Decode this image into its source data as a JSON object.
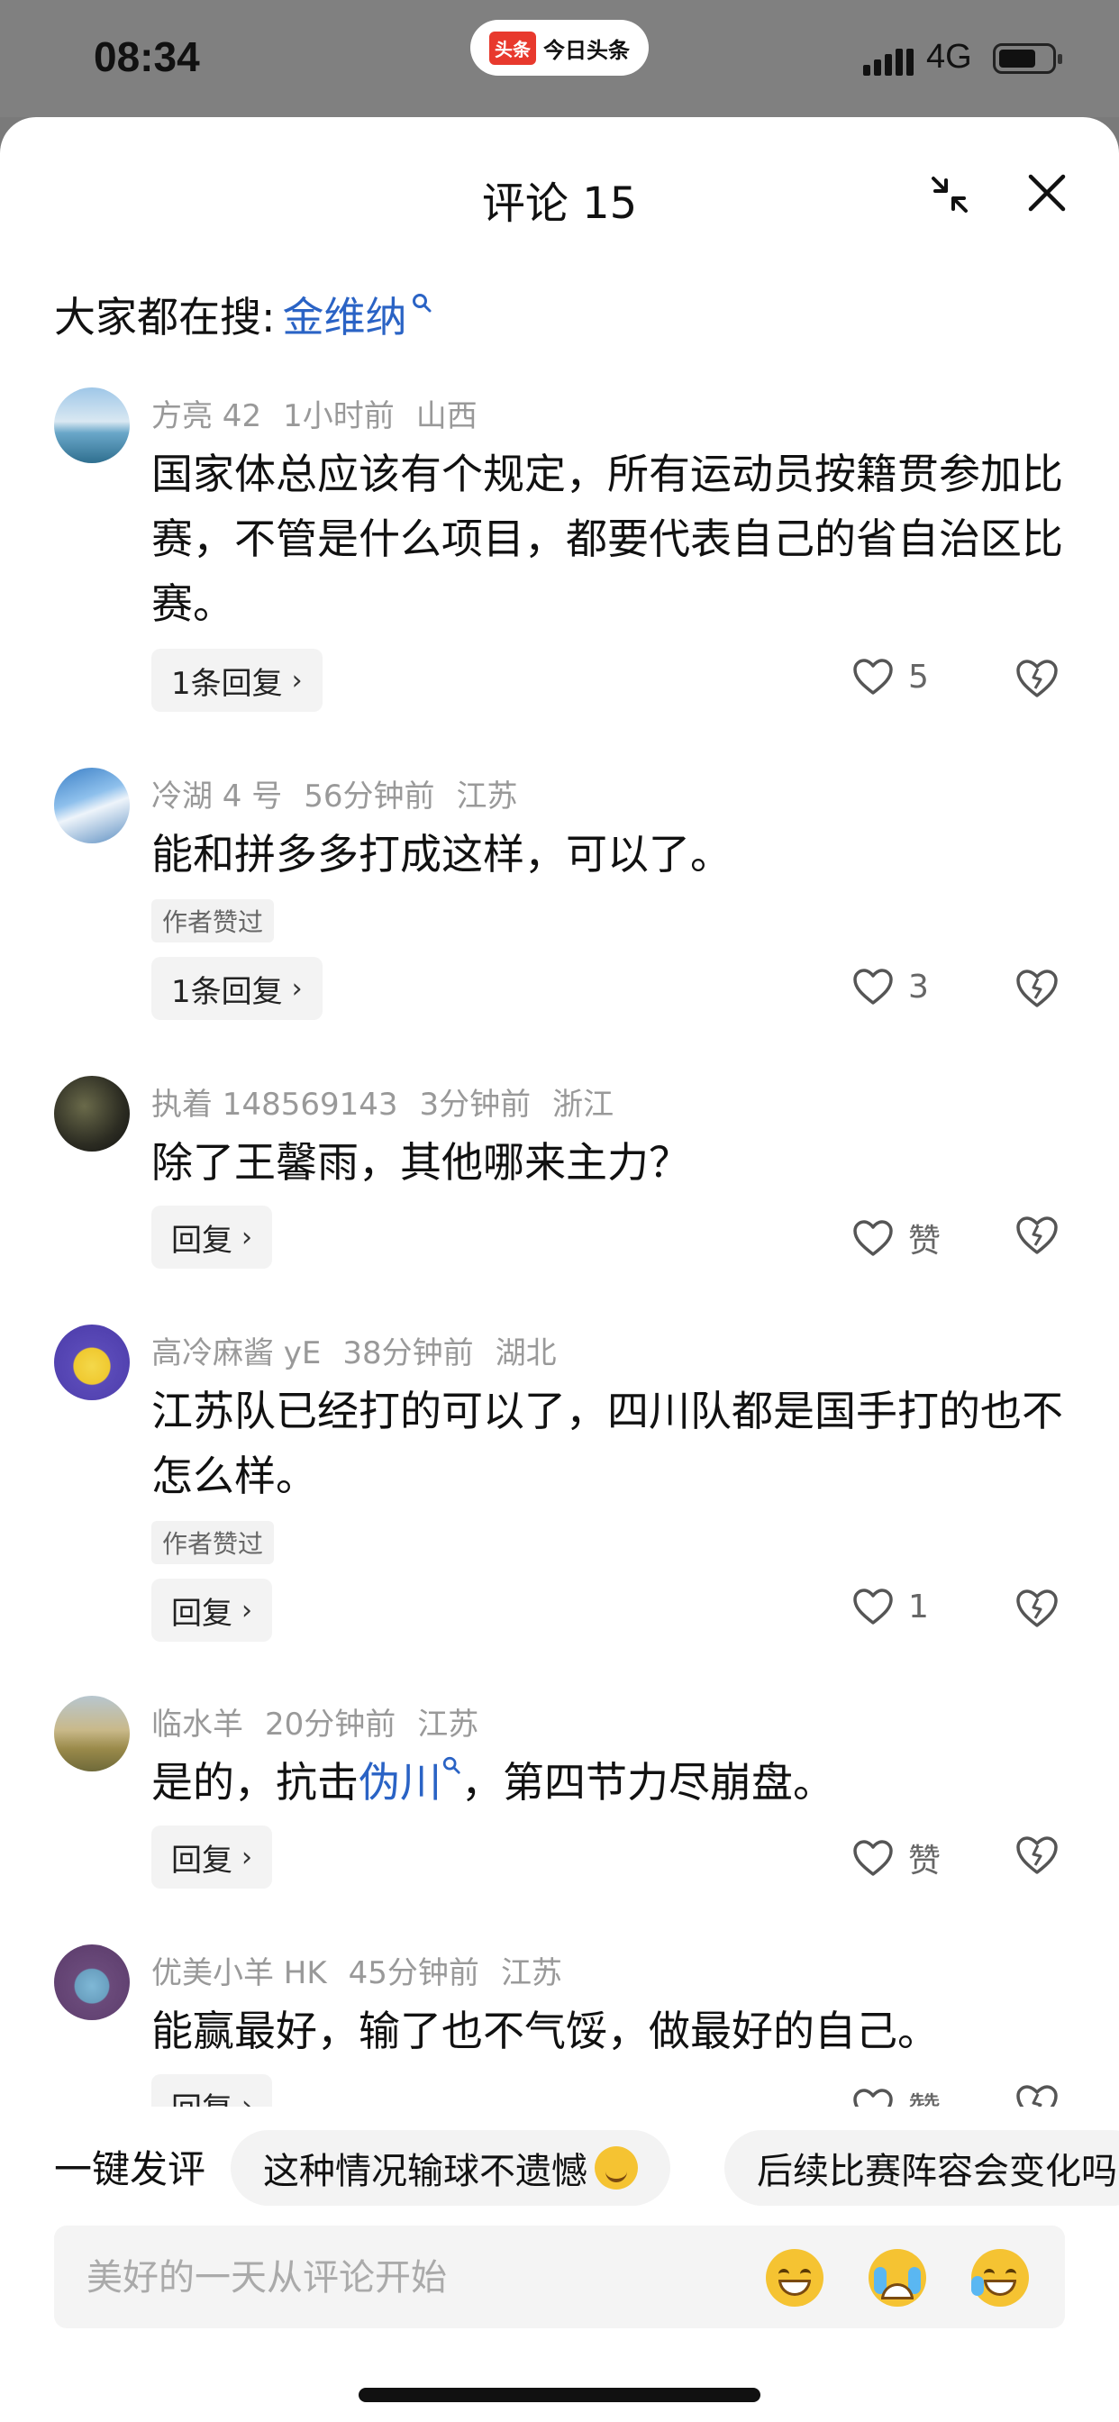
{
  "status_bar": {
    "time": "08:34",
    "app_logo": "头条",
    "app_name": "今日头条",
    "network": "4G"
  },
  "sheet": {
    "title": "评论 15"
  },
  "search_hint": {
    "prefix": "大家都在搜:",
    "keyword": "金维纳"
  },
  "comments": [
    {
      "user": "方亮 42",
      "time": "1小时前",
      "location": "山西",
      "text": "国家体总应该有个规定，所有运动员按籍贯参加比赛，不管是什么项目，都要代表自己的省自治区比赛。",
      "badge": "",
      "reply": "1条回复",
      "likes": "5"
    },
    {
      "user": "冷湖 4 号",
      "time": "56分钟前",
      "location": "江苏",
      "text": "能和拼多多打成这样，可以了。",
      "badge": "作者赞过",
      "reply": "1条回复",
      "likes": "3"
    },
    {
      "user": "执着 148569143",
      "time": "3分钟前",
      "location": "浙江",
      "text": "除了王馨雨，其他哪来主力？",
      "badge": "",
      "reply": "回复",
      "likes": "赞"
    },
    {
      "user": "高冷麻酱 yE",
      "time": "38分钟前",
      "location": "湖北",
      "text": "江苏队已经打的可以了，四川队都是国手打的也不怎么样。",
      "badge": "作者赞过",
      "reply": "回复",
      "likes": "1"
    },
    {
      "user": "临水羊",
      "time": "20分钟前",
      "location": "江苏",
      "text_before": "是的，抗击",
      "text_link": "伪川",
      "text_after": "，第四节力尽崩盘。",
      "badge": "",
      "reply": "回复",
      "likes": "赞"
    },
    {
      "user": "优美小羊 HK",
      "time": "45分钟前",
      "location": "江苏",
      "text": "能赢最好，输了也不气馁，做最好的自己。",
      "badge": "",
      "reply": "回复",
      "likes": "赞"
    }
  ],
  "bottom": {
    "quick_label": "一键发评",
    "chips": [
      "这种情况输球不遗憾",
      "后续比赛阵容会变化吗"
    ],
    "input_placeholder": "美好的一天从评论开始"
  },
  "icons": [
    "collapse-icon",
    "close-icon",
    "heart-icon",
    "dislike-icon",
    "search-icon",
    "chevron-right-icon"
  ],
  "colors": {
    "link": "#2a63c5",
    "logo": "#e8392d",
    "muted": "#999999"
  }
}
